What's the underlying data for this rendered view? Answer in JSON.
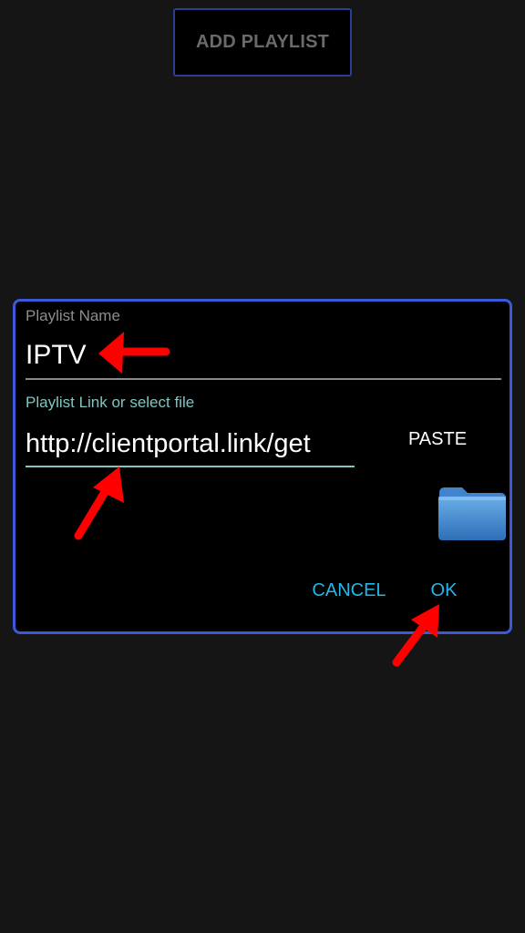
{
  "header": {
    "add_playlist_label": "ADD PLAYLIST"
  },
  "dialog": {
    "name_label": "Playlist Name",
    "name_value": "IPTV",
    "link_label": "Playlist Link or select file",
    "link_value": "http://clientportal.link/get",
    "paste_label": "PASTE",
    "cancel_label": "CANCEL",
    "ok_label": "OK"
  },
  "icons": {
    "folder": "folder-icon",
    "annotation": "red-arrow-icon"
  },
  "colors": {
    "background": "#151515",
    "dialog_border": "#3a5ad8",
    "accent": "#28b5e6",
    "field_underline_active": "#7fc6c2",
    "annotation": "#ff0000"
  }
}
